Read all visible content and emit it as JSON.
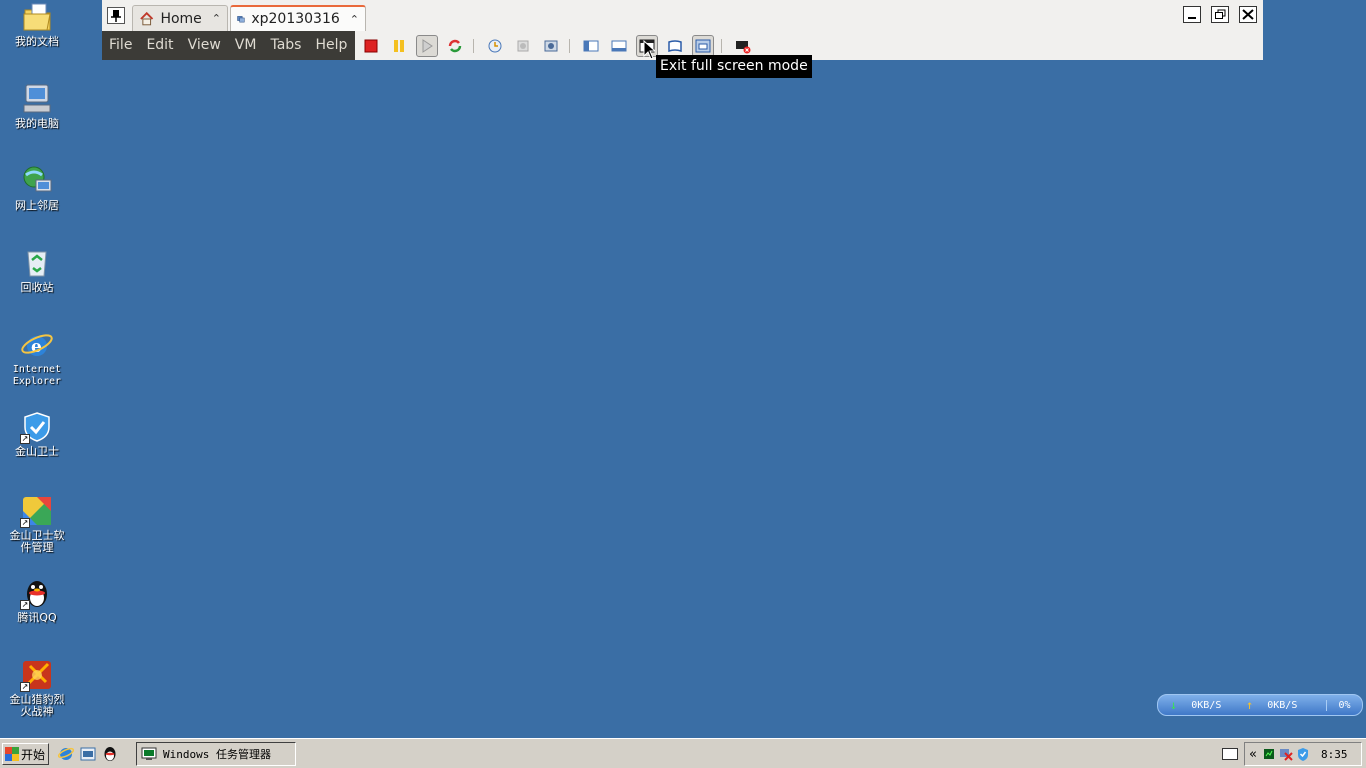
{
  "desktop": {
    "icons": [
      {
        "label": "我的文档",
        "icon": "my-documents-icon"
      },
      {
        "label": "我的电脑",
        "icon": "my-computer-icon"
      },
      {
        "label": "网上邻居",
        "icon": "network-places-icon"
      },
      {
        "label": "回收站",
        "icon": "recycle-bin-icon"
      },
      {
        "label": "Internet\nExplorer",
        "icon": "internet-explorer-icon"
      },
      {
        "label": "金山卫士",
        "icon": "kingsoft-guard-icon"
      },
      {
        "label": "金山卫士软\n件管理",
        "icon": "kingsoft-software-manager-icon"
      },
      {
        "label": "腾讯QQ",
        "icon": "qq-icon"
      },
      {
        "label": "金山猎豹烈\n火战神",
        "icon": "kingsoft-game-icon"
      }
    ]
  },
  "vmware": {
    "tabs": [
      {
        "label": "Home",
        "icon": "home-icon"
      },
      {
        "label": "xp20130316",
        "icon": "vm-icon"
      }
    ],
    "menu": [
      "File",
      "Edit",
      "View",
      "VM",
      "Tabs",
      "Help"
    ],
    "toolbar": [
      {
        "name": "power-off-icon"
      },
      {
        "name": "suspend-icon"
      },
      {
        "name": "power-on-icon"
      },
      {
        "name": "reset-icon"
      },
      {
        "name": "snapshot-icon"
      },
      {
        "name": "revert-snapshot-icon"
      },
      {
        "name": "snapshot-manager-icon"
      },
      {
        "name": "show-sidebar-icon"
      },
      {
        "name": "show-thumbnail-icon"
      },
      {
        "name": "exit-fullscreen-icon"
      },
      {
        "name": "quick-switch-icon"
      },
      {
        "name": "unity-icon"
      },
      {
        "name": "ctrl-alt-del-icon"
      }
    ],
    "tooltip": "Exit full screen mode"
  },
  "netmon": {
    "down": "0KB/S",
    "up": "0KB/S",
    "cpu": "0%"
  },
  "taskbar": {
    "start_label": "开始",
    "task_label": "Windows 任务管理器",
    "chevron": "«",
    "clock": "8:35"
  },
  "colors": {
    "desktop": "#3a6ea5",
    "menubar": "#3c3b37",
    "tab_accent": "#e9693b",
    "taskbar": "#d4d0c8"
  }
}
